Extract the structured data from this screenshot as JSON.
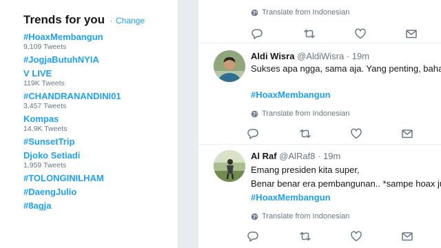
{
  "trends": {
    "title": "Trends for you",
    "dot": "·",
    "change_label": "Change",
    "items": [
      {
        "name": "#HoaxMembangun",
        "count": "9,109 Tweets"
      },
      {
        "name": "#JogjaButuhNYIA",
        "count": ""
      },
      {
        "name": "V LIVE",
        "count": "119K Tweets"
      },
      {
        "name": "#CHANDRANANDINI01",
        "count": "3,457 Tweets"
      },
      {
        "name": "Kompas",
        "count": "14.9K Tweets"
      },
      {
        "name": "#SunsetTrip",
        "count": ""
      },
      {
        "name": "Djoko Setiadi",
        "count": "1,959 Tweets"
      },
      {
        "name": "#TOLONGINILHAM",
        "count": ""
      },
      {
        "name": "#DaengJulio",
        "count": ""
      },
      {
        "name": "#8agja",
        "count": ""
      }
    ]
  },
  "timeline": {
    "partial_tweet": {
      "translate": "Translate from Indonesian"
    },
    "tweets": [
      {
        "name": "Aldi Wisra",
        "handle": "@AldiWisra",
        "sep": "·",
        "time": "19m",
        "lines": [
          "Sukses apa ngga, sama aja. Yang penting, bahag"
        ],
        "hashtag": "#HoaxMembangun",
        "translate": "Translate from Indonesian"
      },
      {
        "name": "Al Raf",
        "handle": "@AlRaf8",
        "sep": "·",
        "time": "19m",
        "lines": [
          "Emang presiden kita super,",
          "Benar benar era pembangunan.. *sampe hoax ju"
        ],
        "hashtag": "#HoaxMembangun",
        "translate": "Translate from Indonesian"
      }
    ]
  },
  "colors": {
    "accent": "#1da1f2",
    "muted": "#657786",
    "background": "#e6ecf0"
  },
  "icons": [
    "globe-icon",
    "reply-icon",
    "retweet-icon",
    "like-icon",
    "message-icon"
  ]
}
